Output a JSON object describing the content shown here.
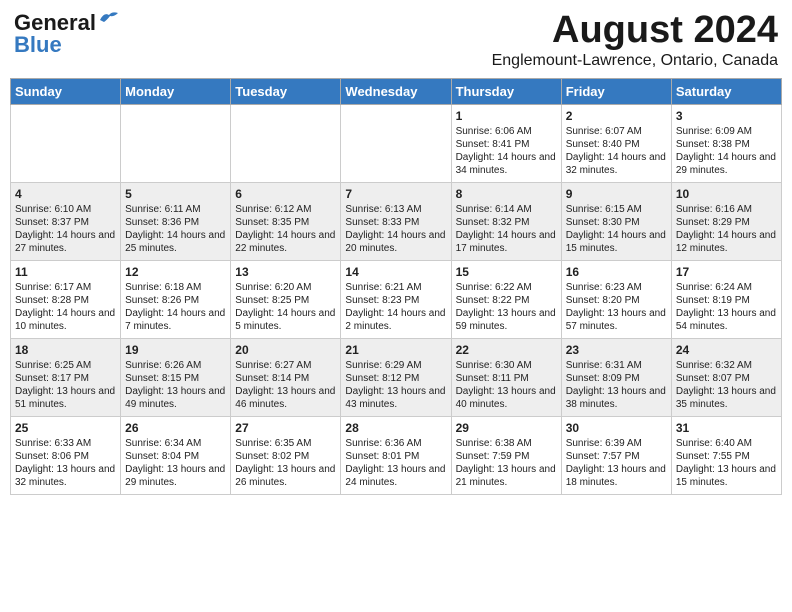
{
  "header": {
    "logo_line1": "General",
    "logo_line2": "Blue",
    "month": "August 2024",
    "location": "Englemount-Lawrence, Ontario, Canada"
  },
  "weekdays": [
    "Sunday",
    "Monday",
    "Tuesday",
    "Wednesday",
    "Thursday",
    "Friday",
    "Saturday"
  ],
  "weeks": [
    [
      {
        "day": "",
        "info": ""
      },
      {
        "day": "",
        "info": ""
      },
      {
        "day": "",
        "info": ""
      },
      {
        "day": "",
        "info": ""
      },
      {
        "day": "1",
        "info": "Sunrise: 6:06 AM\nSunset: 8:41 PM\nDaylight: 14 hours and 34 minutes."
      },
      {
        "day": "2",
        "info": "Sunrise: 6:07 AM\nSunset: 8:40 PM\nDaylight: 14 hours and 32 minutes."
      },
      {
        "day": "3",
        "info": "Sunrise: 6:09 AM\nSunset: 8:38 PM\nDaylight: 14 hours and 29 minutes."
      }
    ],
    [
      {
        "day": "4",
        "info": "Sunrise: 6:10 AM\nSunset: 8:37 PM\nDaylight: 14 hours and 27 minutes."
      },
      {
        "day": "5",
        "info": "Sunrise: 6:11 AM\nSunset: 8:36 PM\nDaylight: 14 hours and 25 minutes."
      },
      {
        "day": "6",
        "info": "Sunrise: 6:12 AM\nSunset: 8:35 PM\nDaylight: 14 hours and 22 minutes."
      },
      {
        "day": "7",
        "info": "Sunrise: 6:13 AM\nSunset: 8:33 PM\nDaylight: 14 hours and 20 minutes."
      },
      {
        "day": "8",
        "info": "Sunrise: 6:14 AM\nSunset: 8:32 PM\nDaylight: 14 hours and 17 minutes."
      },
      {
        "day": "9",
        "info": "Sunrise: 6:15 AM\nSunset: 8:30 PM\nDaylight: 14 hours and 15 minutes."
      },
      {
        "day": "10",
        "info": "Sunrise: 6:16 AM\nSunset: 8:29 PM\nDaylight: 14 hours and 12 minutes."
      }
    ],
    [
      {
        "day": "11",
        "info": "Sunrise: 6:17 AM\nSunset: 8:28 PM\nDaylight: 14 hours and 10 minutes."
      },
      {
        "day": "12",
        "info": "Sunrise: 6:18 AM\nSunset: 8:26 PM\nDaylight: 14 hours and 7 minutes."
      },
      {
        "day": "13",
        "info": "Sunrise: 6:20 AM\nSunset: 8:25 PM\nDaylight: 14 hours and 5 minutes."
      },
      {
        "day": "14",
        "info": "Sunrise: 6:21 AM\nSunset: 8:23 PM\nDaylight: 14 hours and 2 minutes."
      },
      {
        "day": "15",
        "info": "Sunrise: 6:22 AM\nSunset: 8:22 PM\nDaylight: 13 hours and 59 minutes."
      },
      {
        "day": "16",
        "info": "Sunrise: 6:23 AM\nSunset: 8:20 PM\nDaylight: 13 hours and 57 minutes."
      },
      {
        "day": "17",
        "info": "Sunrise: 6:24 AM\nSunset: 8:19 PM\nDaylight: 13 hours and 54 minutes."
      }
    ],
    [
      {
        "day": "18",
        "info": "Sunrise: 6:25 AM\nSunset: 8:17 PM\nDaylight: 13 hours and 51 minutes."
      },
      {
        "day": "19",
        "info": "Sunrise: 6:26 AM\nSunset: 8:15 PM\nDaylight: 13 hours and 49 minutes."
      },
      {
        "day": "20",
        "info": "Sunrise: 6:27 AM\nSunset: 8:14 PM\nDaylight: 13 hours and 46 minutes."
      },
      {
        "day": "21",
        "info": "Sunrise: 6:29 AM\nSunset: 8:12 PM\nDaylight: 13 hours and 43 minutes."
      },
      {
        "day": "22",
        "info": "Sunrise: 6:30 AM\nSunset: 8:11 PM\nDaylight: 13 hours and 40 minutes."
      },
      {
        "day": "23",
        "info": "Sunrise: 6:31 AM\nSunset: 8:09 PM\nDaylight: 13 hours and 38 minutes."
      },
      {
        "day": "24",
        "info": "Sunrise: 6:32 AM\nSunset: 8:07 PM\nDaylight: 13 hours and 35 minutes."
      }
    ],
    [
      {
        "day": "25",
        "info": "Sunrise: 6:33 AM\nSunset: 8:06 PM\nDaylight: 13 hours and 32 minutes."
      },
      {
        "day": "26",
        "info": "Sunrise: 6:34 AM\nSunset: 8:04 PM\nDaylight: 13 hours and 29 minutes."
      },
      {
        "day": "27",
        "info": "Sunrise: 6:35 AM\nSunset: 8:02 PM\nDaylight: 13 hours and 26 minutes."
      },
      {
        "day": "28",
        "info": "Sunrise: 6:36 AM\nSunset: 8:01 PM\nDaylight: 13 hours and 24 minutes."
      },
      {
        "day": "29",
        "info": "Sunrise: 6:38 AM\nSunset: 7:59 PM\nDaylight: 13 hours and 21 minutes."
      },
      {
        "day": "30",
        "info": "Sunrise: 6:39 AM\nSunset: 7:57 PM\nDaylight: 13 hours and 18 minutes."
      },
      {
        "day": "31",
        "info": "Sunrise: 6:40 AM\nSunset: 7:55 PM\nDaylight: 13 hours and 15 minutes."
      }
    ]
  ]
}
